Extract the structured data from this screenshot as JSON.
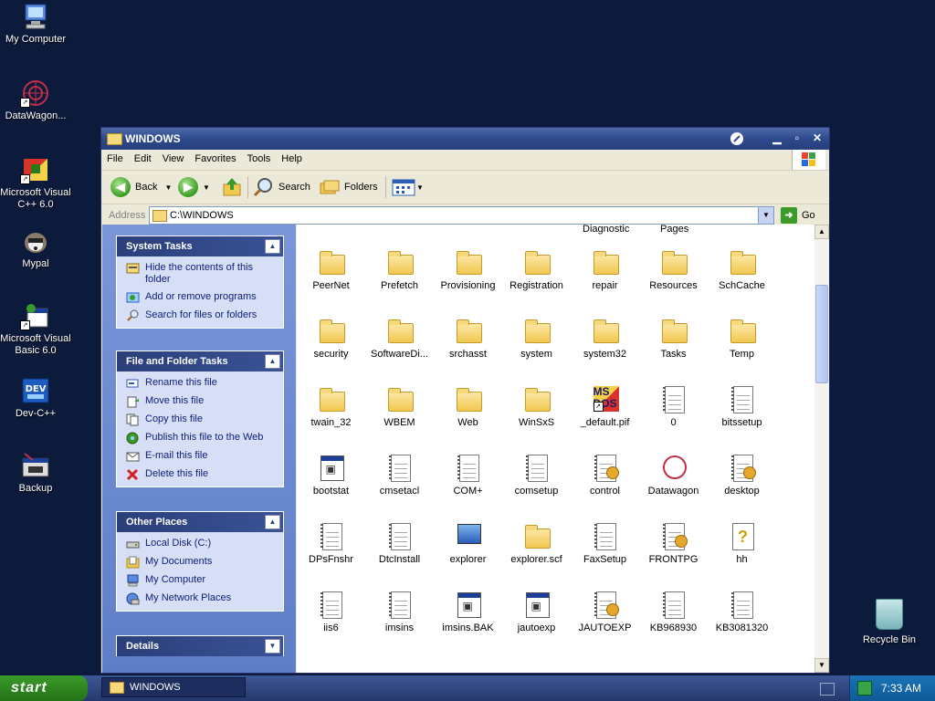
{
  "desktop": {
    "icons": [
      {
        "label": "My Computer",
        "icon": "my-computer-icon"
      },
      {
        "label": "DataWagon...",
        "icon": "datawagon-icon"
      },
      {
        "label": "Microsoft Visual C++ 6.0",
        "icon": "visual-cpp-icon"
      },
      {
        "label": "Mypal",
        "icon": "mypal-icon"
      },
      {
        "label": "Microsoft Visual Basic 6.0",
        "icon": "visual-basic-icon"
      },
      {
        "label": "Dev-C++",
        "icon": "dev-cpp-icon"
      },
      {
        "label": "Backup",
        "icon": "backup-icon"
      }
    ],
    "recycle_bin": "Recycle Bin"
  },
  "window": {
    "title": "WINDOWS",
    "menu": [
      "File",
      "Edit",
      "View",
      "Favorites",
      "Tools",
      "Help"
    ],
    "toolbar": {
      "back": "Back",
      "search": "Search",
      "folders": "Folders"
    },
    "address": {
      "label": "Address",
      "value": "C:\\WINDOWS",
      "go": "Go"
    }
  },
  "tasks": {
    "system_tasks": {
      "title": "System Tasks",
      "items": [
        "Hide the contents of this folder",
        "Add or remove programs",
        "Search for files or folders"
      ]
    },
    "file_folder_tasks": {
      "title": "File and Folder Tasks",
      "items": [
        "Rename this file",
        "Move this file",
        "Copy this file",
        "Publish this file to the Web",
        "E-mail this file",
        "Delete this file"
      ]
    },
    "other_places": {
      "title": "Other Places",
      "items": [
        "Local Disk (C:)",
        "My Documents",
        "My Computer",
        "My Network Places"
      ]
    },
    "details": {
      "title": "Details"
    }
  },
  "content": {
    "partial_labels": [
      "Diagnostic",
      "Pages"
    ],
    "items": [
      {
        "name": "PeerNet",
        "type": "folder"
      },
      {
        "name": "Prefetch",
        "type": "folder"
      },
      {
        "name": "Provisioning",
        "type": "folder"
      },
      {
        "name": "Registration",
        "type": "folder"
      },
      {
        "name": "repair",
        "type": "folder"
      },
      {
        "name": "Resources",
        "type": "folder"
      },
      {
        "name": "SchCache",
        "type": "folder"
      },
      {
        "name": "security",
        "type": "folder"
      },
      {
        "name": "SoftwareDi...",
        "type": "folder"
      },
      {
        "name": "srchasst",
        "type": "folder"
      },
      {
        "name": "system",
        "type": "folder"
      },
      {
        "name": "system32",
        "type": "folder"
      },
      {
        "name": "Tasks",
        "type": "folder"
      },
      {
        "name": "Temp",
        "type": "folder"
      },
      {
        "name": "twain_32",
        "type": "folder"
      },
      {
        "name": "WBEM",
        "type": "folder"
      },
      {
        "name": "Web",
        "type": "folder"
      },
      {
        "name": "WinSxS",
        "type": "folder"
      },
      {
        "name": "_default.pif",
        "type": "pif"
      },
      {
        "name": "0",
        "type": "doc"
      },
      {
        "name": "bitssetup",
        "type": "doc"
      },
      {
        "name": "bootstat",
        "type": "app"
      },
      {
        "name": "cmsetacl",
        "type": "doc"
      },
      {
        "name": "COM+",
        "type": "doc"
      },
      {
        "name": "comsetup",
        "type": "doc"
      },
      {
        "name": "control",
        "type": "config"
      },
      {
        "name": "Datawagon",
        "type": "datawagon"
      },
      {
        "name": "desktop",
        "type": "config"
      },
      {
        "name": "DPsFnshr",
        "type": "doc"
      },
      {
        "name": "DtcInstall",
        "type": "doc"
      },
      {
        "name": "explorer",
        "type": "monitor"
      },
      {
        "name": "explorer.scf",
        "type": "search"
      },
      {
        "name": "FaxSetup",
        "type": "doc"
      },
      {
        "name": "FRONTPG",
        "type": "config"
      },
      {
        "name": "hh",
        "type": "help"
      },
      {
        "name": "iis6",
        "type": "doc"
      },
      {
        "name": "imsins",
        "type": "doc"
      },
      {
        "name": "imsins.BAK",
        "type": "app"
      },
      {
        "name": "jautoexp",
        "type": "app"
      },
      {
        "name": "JAUTOEXP",
        "type": "config"
      },
      {
        "name": "KB968930",
        "type": "doc"
      },
      {
        "name": "KB3081320",
        "type": "doc"
      }
    ]
  },
  "taskbar": {
    "start": "start",
    "task_item": "WINDOWS",
    "clock": "7:33 AM"
  },
  "colors": {
    "desktop": "#0c1a3b",
    "titlebar": "#2e4a8c",
    "taskpane": "#6d8ad0",
    "start": "#2f8a22"
  }
}
